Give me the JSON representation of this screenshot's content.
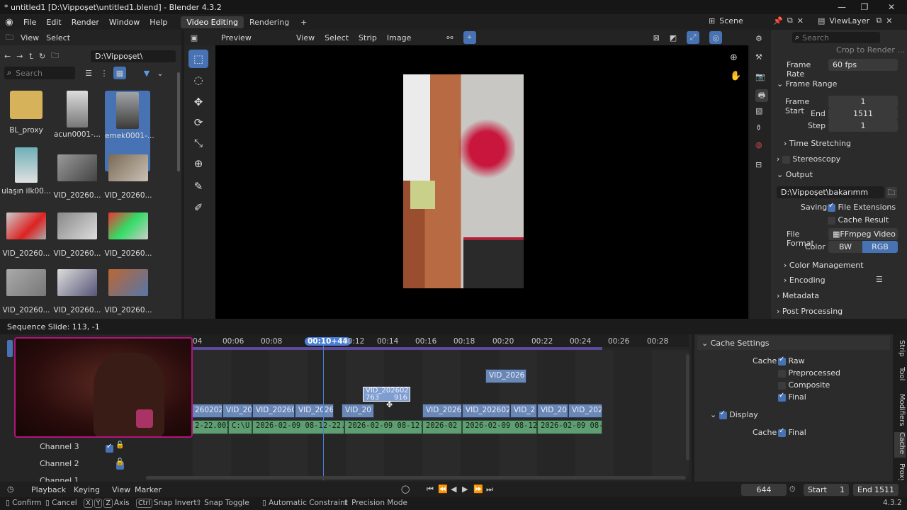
{
  "window": {
    "title": "* untitled1 [D:\\Vippoşet\\untitled1.blend] - Blender 4.3.2"
  },
  "menu": {
    "file": "File",
    "edit": "Edit",
    "render": "Render",
    "window": "Window",
    "help": "Help"
  },
  "workspaces": {
    "video_editing": "Video Editing",
    "rendering": "Rendering",
    "add": "+"
  },
  "topright": {
    "scene": "Scene",
    "viewlayer": "ViewLayer"
  },
  "filebrowser": {
    "view": "View",
    "select": "Select",
    "path": "D:\\Vippoşet\\",
    "search_placeholder": "Search",
    "items": [
      {
        "label": "BL_proxy"
      },
      {
        "label": "acun0001-..."
      },
      {
        "label": "emek0001-..."
      },
      {
        "label": "ulaşın ilk00..."
      },
      {
        "label": "VID_20260..."
      },
      {
        "label": "VID_20260..."
      },
      {
        "label": "VID_20260..."
      },
      {
        "label": "VID_20260..."
      },
      {
        "label": "VID_20260..."
      },
      {
        "label": "VID_20260..."
      },
      {
        "label": "VID_20260..."
      },
      {
        "label": "VID_20260..."
      }
    ]
  },
  "preview": {
    "mode": "Preview",
    "view": "View",
    "select": "Select",
    "strip": "Strip",
    "image": "Image"
  },
  "properties": {
    "search_placeholder": "Search",
    "crop_to_render": "Crop to Render ...",
    "frame_rate_label": "Frame Rate",
    "frame_rate": "60 fps",
    "frame_range": "Frame Range",
    "frame_start_label": "Frame Start",
    "frame_start": "1",
    "end_label": "End",
    "end": "1511",
    "step_label": "Step",
    "step": "1",
    "time_stretching": "Time Stretching",
    "stereoscopy": "Stereoscopy",
    "output": "Output",
    "output_path": "D:\\Vippoşet\\bakarımm",
    "saving_label": "Saving",
    "file_extensions": "File Extensions",
    "cache_result": "Cache Result",
    "file_format_label": "File Format",
    "file_format": "FFmpeg Video",
    "color_label": "Color",
    "bw": "BW",
    "rgb": "RGB",
    "color_management": "Color Management",
    "encoding": "Encoding",
    "metadata": "Metadata",
    "post_processing": "Post Processing"
  },
  "sequencer": {
    "header_text": "Sequence Slide: 113, -1",
    "ticks": [
      "04",
      "00:06",
      "00:08",
      "00:10+44",
      "00:12",
      "00:14",
      "00:16",
      "00:18",
      "00:20",
      "00:22",
      "00:24",
      "00:26",
      "00:28"
    ],
    "current_time": "00:10+44",
    "channels": [
      "Channel 3",
      "Channel 2",
      "Channel 1"
    ],
    "video_strips": [
      "260202",
      "VID_20",
      "VID_20260",
      "VID_2026",
      "VID_20",
      "VID_2026",
      "VID_202602",
      "VID_2",
      "VID_20",
      "VID_202"
    ],
    "audio_strips": [
      "2-22.002",
      "C:\\U",
      "2026-02-09 08-12-22.0",
      "2026-02-09 08-12-",
      "2026-02",
      "2026-02-09 08-12",
      "2026-02-09 08-"
    ],
    "top_strip": "VID_2026",
    "moving_strip": {
      "name": "VID_202602",
      "start": "763",
      "end": "916"
    }
  },
  "sidebar": {
    "cache_settings": "Cache Settings",
    "cache_label": "Cache",
    "raw": "Raw",
    "preprocessed": "Preprocessed",
    "composite": "Composite",
    "final": "Final",
    "display": "Display",
    "display_cache_label": "Cache",
    "display_final": "Final",
    "tabs": [
      "Strip",
      "Tool",
      "Modifiers",
      "Cache",
      "Proxy"
    ]
  },
  "timeline": {
    "playback": "Playback",
    "keying": "Keying",
    "view": "View",
    "marker": "Marker",
    "current_frame": "644",
    "start_label": "Start",
    "start": "1",
    "end_label": "End",
    "end": "1511"
  },
  "statusbar": {
    "confirm": "Confirm",
    "cancel": "Cancel",
    "x": "X",
    "y": "Y",
    "z": "Z",
    "axis": "Axis",
    "ctrl": "Ctrl",
    "snap_invert": "Snap Invert",
    "snap_toggle": "Snap Toggle",
    "auto_constraint": "Automatic Constraint",
    "precision_mode": "Precision Mode",
    "version": "4.3.2"
  },
  "colors": {
    "accent": "#4772b3",
    "strip_video": "#6a88b5",
    "strip_audio": "#5f9e73",
    "playhead": "#4b7fd6"
  }
}
